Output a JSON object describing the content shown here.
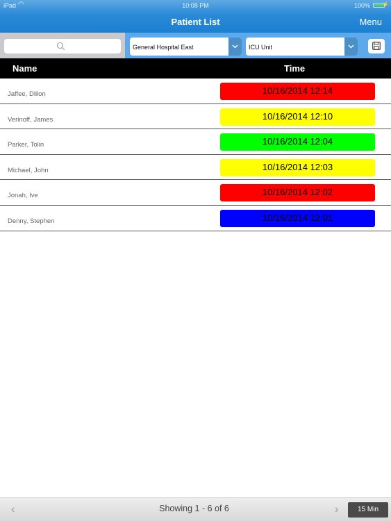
{
  "status_bar": {
    "carrier": "iPad",
    "wifi_icon": "wifi-icon",
    "time": "10:08 PM",
    "battery_percent": "100%",
    "battery_icon": "battery-icon",
    "charging_icon": "bolt-icon"
  },
  "navbar": {
    "title": "Patient List",
    "menu_label": "Menu"
  },
  "toolbar": {
    "search": {
      "value": "",
      "placeholder": "",
      "icon": "search-icon"
    },
    "hospital_select": {
      "selected": "General Hospital East",
      "icon": "chevron-down-icon"
    },
    "unit_select": {
      "selected": "ICU Unit",
      "icon": "chevron-down-icon"
    },
    "save_icon": "floppy-disk-icon"
  },
  "table": {
    "columns": [
      "Name",
      "Time"
    ],
    "rows": [
      {
        "name": "Jaffee, Dillon",
        "time": "10/16/2014 12:14",
        "status_color": "#ff0000"
      },
      {
        "name": "Verinoff, James",
        "time": "10/16/2014 12:10",
        "status_color": "#ffff00"
      },
      {
        "name": "Parker, Tolin",
        "time": "10/16/2014 12:04",
        "status_color": "#00ff00"
      },
      {
        "name": "Michael, John",
        "time": "10/16/2014 12:03",
        "status_color": "#ffff00"
      },
      {
        "name": "Jonah, Ive",
        "time": "10/16/2014 12:02",
        "status_color": "#ff0000"
      },
      {
        "name": "Denny, Stephen",
        "time": "10/16/2014 12:01",
        "status_color": "#0000ff"
      }
    ]
  },
  "footer": {
    "prev_icon": "chevron-left-icon",
    "showing_text": "Showing 1 - 6 of 6",
    "next_icon": "chevron-right-icon",
    "interval_label": "15 Min"
  },
  "colors": {
    "nav_accent": "#1b7fd0",
    "toolbar_bg": "#5ea8ec",
    "header_bg": "#000000"
  }
}
